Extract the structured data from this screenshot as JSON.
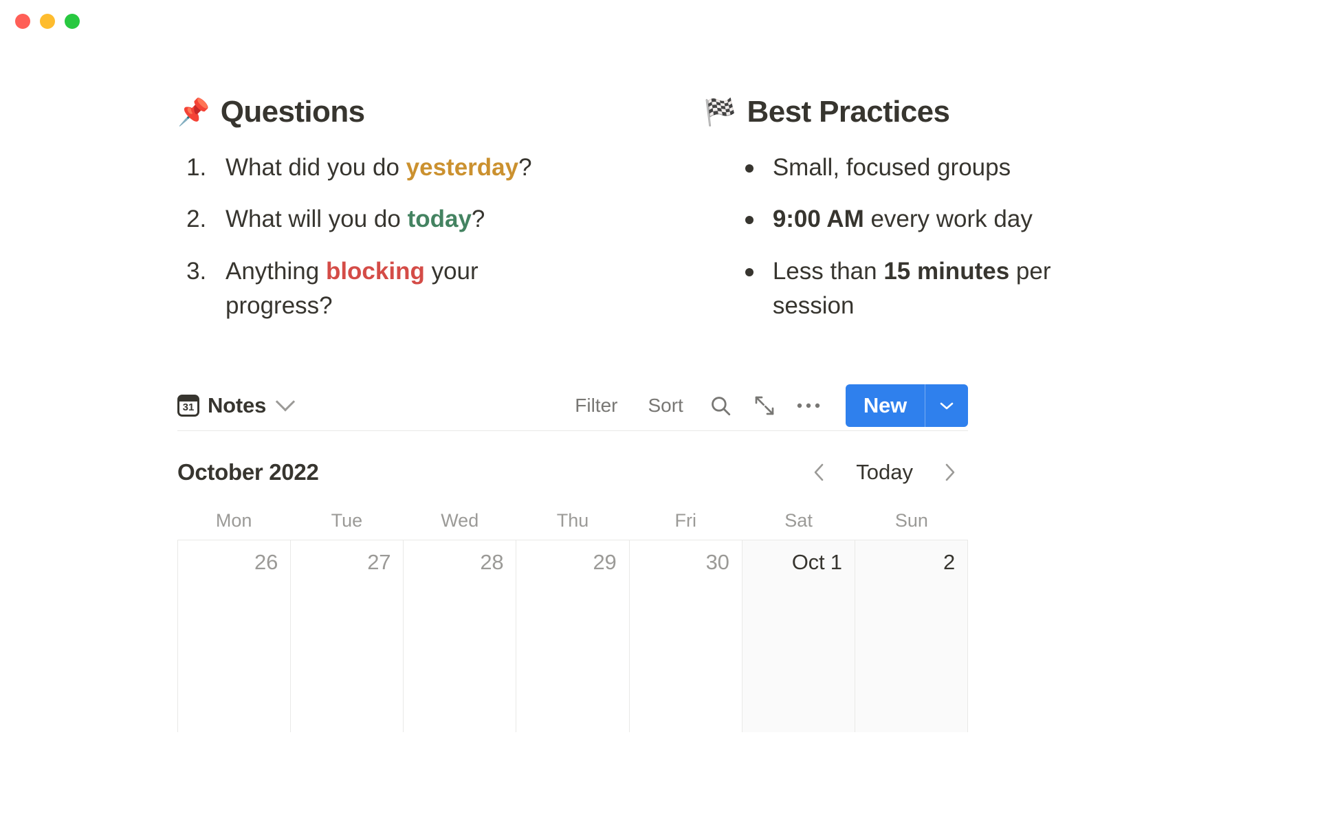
{
  "window": {
    "traffic_lights": [
      {
        "name": "close",
        "color": "#ff5f57"
      },
      {
        "name": "minimize",
        "color": "#febc2e"
      },
      {
        "name": "maximize",
        "color": "#28c840"
      }
    ]
  },
  "questions": {
    "emoji": "📌",
    "title": "Questions",
    "items": [
      {
        "pre": "What did you do ",
        "highlight": "yesterday",
        "post": "?",
        "highlight_color": "#cb912f"
      },
      {
        "pre": "What will you do ",
        "highlight": "today",
        "post": "?",
        "highlight_color": "#448361"
      },
      {
        "pre": "Anything ",
        "highlight": "blocking",
        "post": " your progress?",
        "highlight_color": "#d44c47"
      }
    ]
  },
  "best_practices": {
    "emoji": "🏁",
    "title": "Best Practices",
    "items": [
      {
        "pre": "Small, focused groups",
        "bold": "",
        "post": ""
      },
      {
        "pre": "",
        "bold": "9:00 AM",
        "post": " every work day"
      },
      {
        "pre": "Less than ",
        "bold": "15 minutes",
        "post": " per session"
      }
    ]
  },
  "toolbar": {
    "db_icon_label": "31",
    "db_name": "Notes",
    "filter_label": "Filter",
    "sort_label": "Sort",
    "search_icon": "search-icon",
    "expand_icon": "expand-icon",
    "more_icon": "more-options-icon",
    "new_label": "New",
    "new_caret_icon": "chevron-down-icon",
    "accent_color": "#2f80ed"
  },
  "calendar": {
    "month_label": "October 2022",
    "today_label": "Today",
    "prev_icon": "chevron-left-icon",
    "next_icon": "chevron-right-icon",
    "day_names": [
      "Mon",
      "Tue",
      "Wed",
      "Thu",
      "Fri",
      "Sat",
      "Sun"
    ],
    "cells": [
      {
        "label": "26",
        "current_month": false,
        "weekend": false
      },
      {
        "label": "27",
        "current_month": false,
        "weekend": false
      },
      {
        "label": "28",
        "current_month": false,
        "weekend": false
      },
      {
        "label": "29",
        "current_month": false,
        "weekend": false
      },
      {
        "label": "30",
        "current_month": false,
        "weekend": false
      },
      {
        "label": "Oct 1",
        "current_month": true,
        "weekend": true
      },
      {
        "label": "2",
        "current_month": true,
        "weekend": true
      }
    ]
  }
}
